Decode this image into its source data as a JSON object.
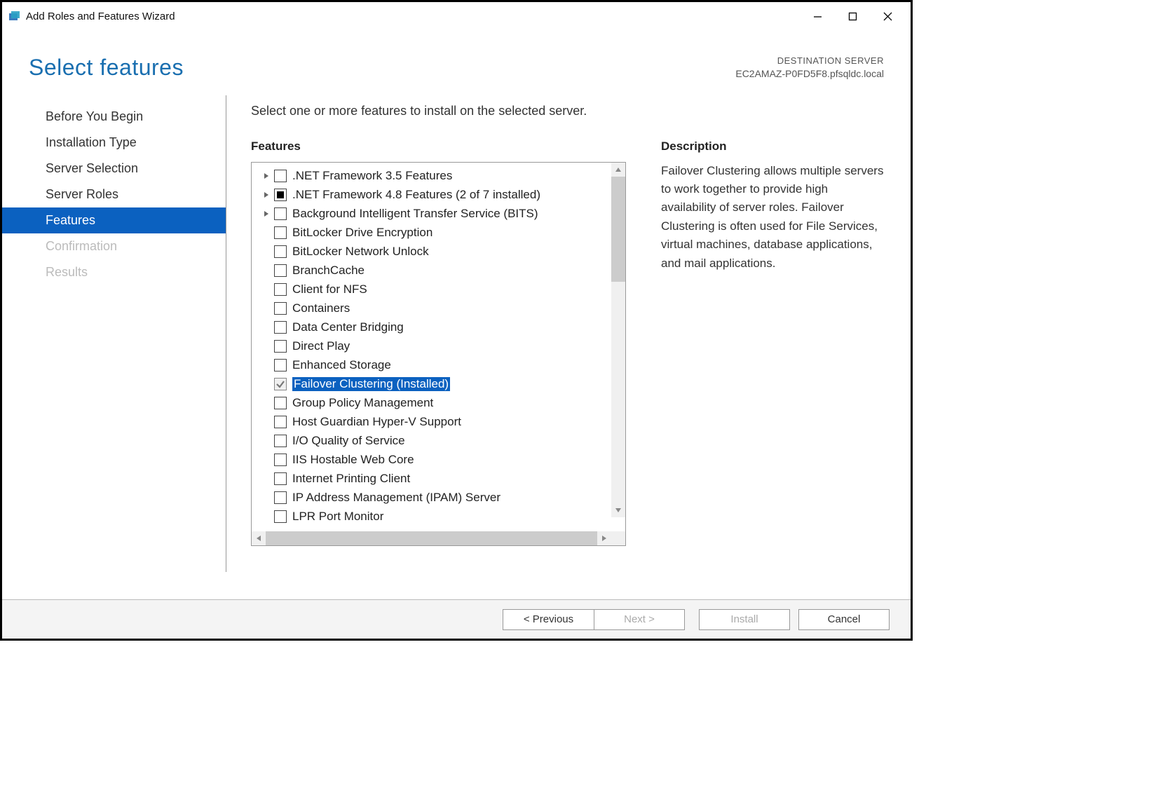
{
  "window": {
    "title": "Add Roles and Features Wizard"
  },
  "header": {
    "page_title": "Select features",
    "destination_label": "DESTINATION SERVER",
    "destination_name": "EC2AMAZ-P0FD5F8.pfsqldc.local"
  },
  "sidebar": {
    "items": [
      {
        "label": "Before You Begin",
        "active": false,
        "disabled": false
      },
      {
        "label": "Installation Type",
        "active": false,
        "disabled": false
      },
      {
        "label": "Server Selection",
        "active": false,
        "disabled": false
      },
      {
        "label": "Server Roles",
        "active": false,
        "disabled": false
      },
      {
        "label": "Features",
        "active": true,
        "disabled": false
      },
      {
        "label": "Confirmation",
        "active": false,
        "disabled": true
      },
      {
        "label": "Results",
        "active": false,
        "disabled": true
      }
    ]
  },
  "content": {
    "instruction": "Select one or more features to install on the selected server.",
    "features_heading": "Features",
    "description_heading": "Description",
    "description_text": "Failover Clustering allows multiple servers to work together to provide high availability of server roles. Failover Clustering is often used for File Services, virtual machines, database applications, and mail applications.",
    "features": [
      {
        "label": ".NET Framework 3.5 Features",
        "expandable": true,
        "state": "unchecked",
        "selected": false
      },
      {
        "label": ".NET Framework 4.8 Features (2 of 7 installed)",
        "expandable": true,
        "state": "indeterminate",
        "selected": false
      },
      {
        "label": "Background Intelligent Transfer Service (BITS)",
        "expandable": true,
        "state": "unchecked",
        "selected": false
      },
      {
        "label": "BitLocker Drive Encryption",
        "expandable": false,
        "state": "unchecked",
        "selected": false
      },
      {
        "label": "BitLocker Network Unlock",
        "expandable": false,
        "state": "unchecked",
        "selected": false
      },
      {
        "label": "BranchCache",
        "expandable": false,
        "state": "unchecked",
        "selected": false
      },
      {
        "label": "Client for NFS",
        "expandable": false,
        "state": "unchecked",
        "selected": false
      },
      {
        "label": "Containers",
        "expandable": false,
        "state": "unchecked",
        "selected": false
      },
      {
        "label": "Data Center Bridging",
        "expandable": false,
        "state": "unchecked",
        "selected": false
      },
      {
        "label": "Direct Play",
        "expandable": false,
        "state": "unchecked",
        "selected": false
      },
      {
        "label": "Enhanced Storage",
        "expandable": false,
        "state": "unchecked",
        "selected": false
      },
      {
        "label": "Failover Clustering (Installed)",
        "expandable": false,
        "state": "checked",
        "selected": true
      },
      {
        "label": "Group Policy Management",
        "expandable": false,
        "state": "unchecked",
        "selected": false
      },
      {
        "label": "Host Guardian Hyper-V Support",
        "expandable": false,
        "state": "unchecked",
        "selected": false
      },
      {
        "label": "I/O Quality of Service",
        "expandable": false,
        "state": "unchecked",
        "selected": false
      },
      {
        "label": "IIS Hostable Web Core",
        "expandable": false,
        "state": "unchecked",
        "selected": false
      },
      {
        "label": "Internet Printing Client",
        "expandable": false,
        "state": "unchecked",
        "selected": false
      },
      {
        "label": "IP Address Management (IPAM) Server",
        "expandable": false,
        "state": "unchecked",
        "selected": false
      },
      {
        "label": "LPR Port Monitor",
        "expandable": false,
        "state": "unchecked",
        "selected": false
      }
    ]
  },
  "footer": {
    "previous": "< Previous",
    "next": "Next >",
    "install": "Install",
    "cancel": "Cancel"
  }
}
